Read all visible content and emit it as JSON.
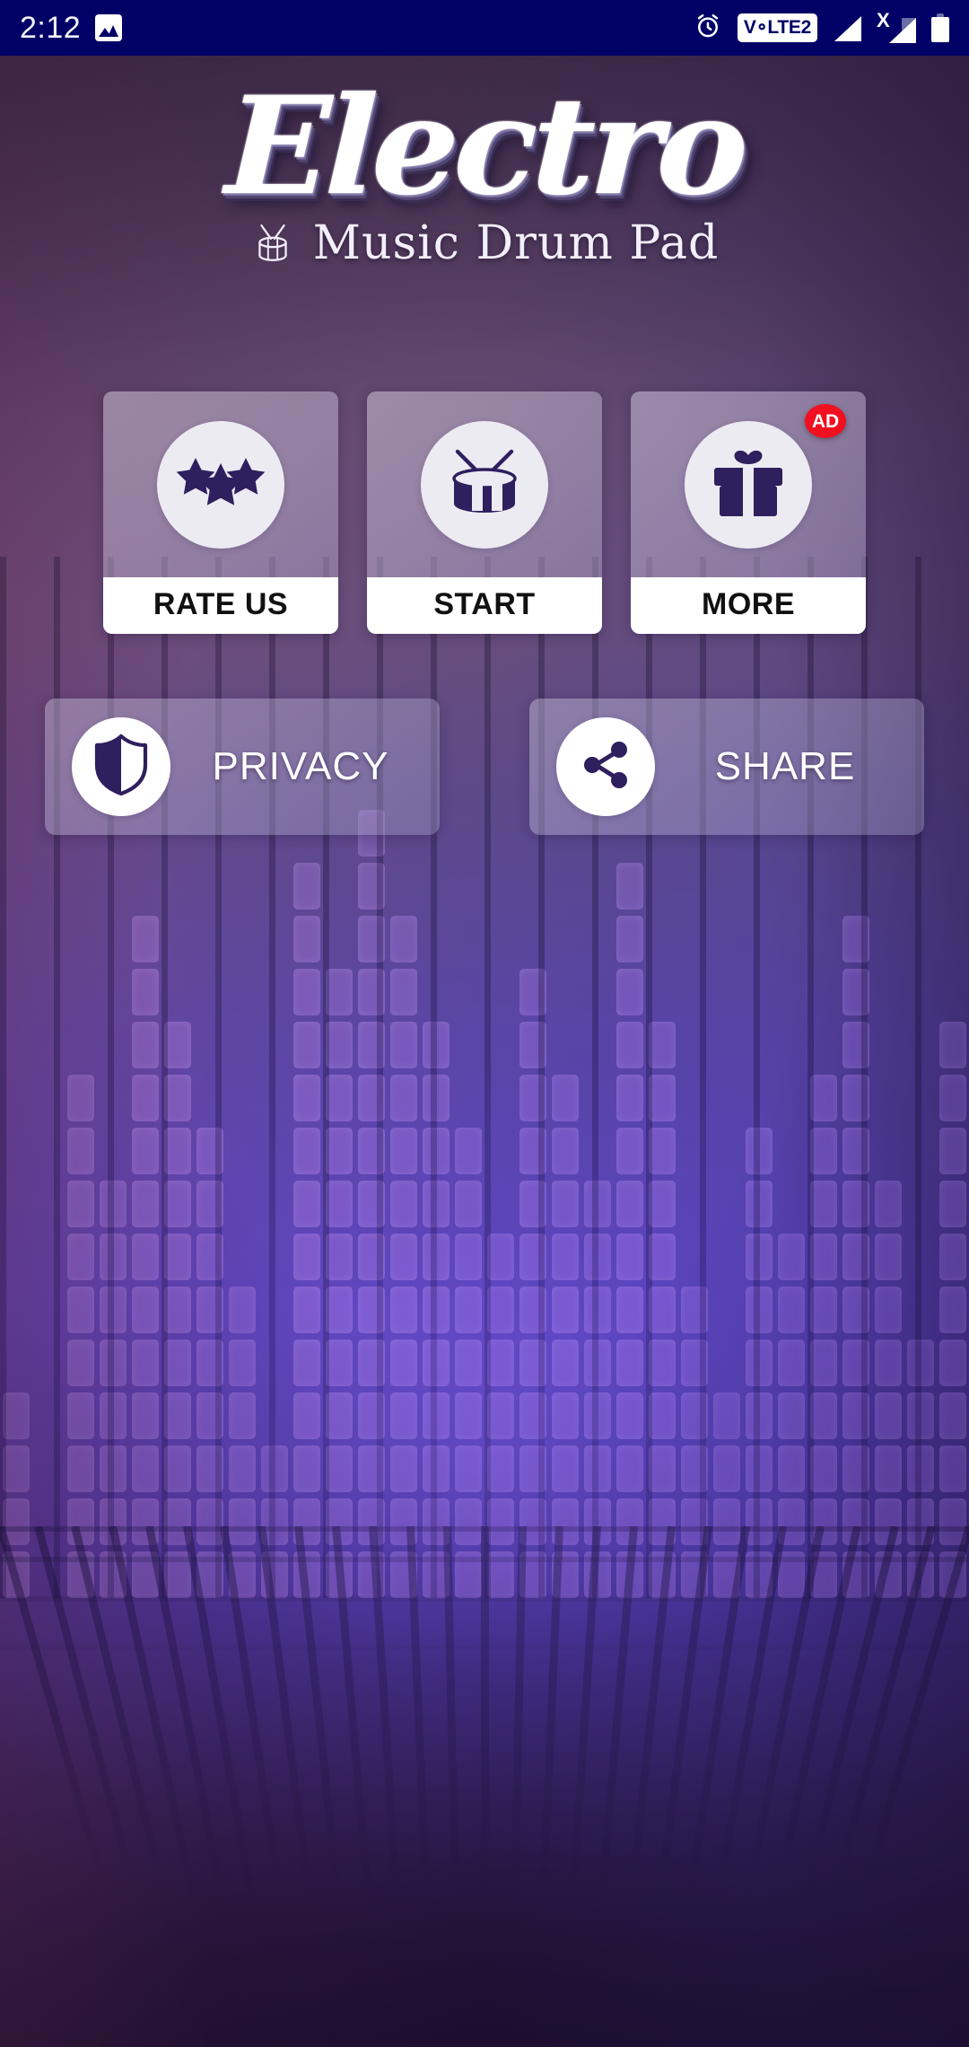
{
  "statusbar": {
    "time": "2:12",
    "photo_icon": "photo-icon",
    "alarm_icon": "alarm-clock-icon",
    "volte_label": "V∘LTE2",
    "signal_icon": "signal-bars-icon",
    "signal_x_icon": "signal-no-service-icon",
    "signal_x_label": "X",
    "battery_icon": "battery-icon",
    "bg_color": "#000066"
  },
  "brand": {
    "title": "Electro",
    "subtitle": "Music Drum Pad",
    "drum_icon": "drum-icon"
  },
  "tiles": [
    {
      "id": "rate-us",
      "label": "RATE US",
      "icon": "three-stars-icon",
      "badge": null
    },
    {
      "id": "start",
      "label": "START",
      "icon": "drum-sticks-icon",
      "badge": null
    },
    {
      "id": "more",
      "label": "MORE",
      "icon": "gift-box-icon",
      "badge": "AD"
    }
  ],
  "pills": [
    {
      "id": "privacy",
      "label": "PRIVACY",
      "icon": "shield-icon"
    },
    {
      "id": "share",
      "label": "SHARE",
      "icon": "share-nodes-icon"
    }
  ],
  "theme": {
    "icon_purple": "#2e1f5e",
    "accent_red": "#f01020",
    "label_white": "#ffffff",
    "circle_grey": "#ecebf2",
    "status_navy": "#000066"
  }
}
